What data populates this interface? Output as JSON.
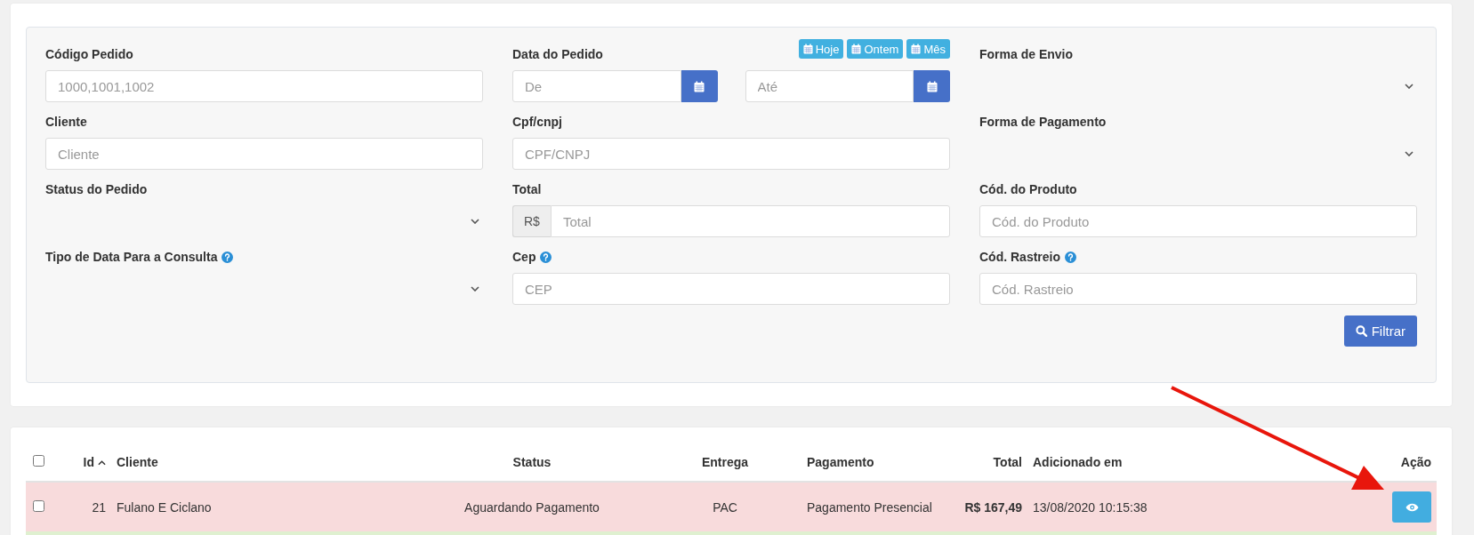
{
  "filters": {
    "fields": [
      {
        "kind": "text",
        "label": "Código Pedido",
        "placeholder": "1000,1001,1002",
        "help": false
      },
      {
        "kind": "date_range",
        "label": "Data do Pedido",
        "from_placeholder": "De",
        "to_placeholder": "Até",
        "quick_buttons": [
          "Hoje",
          "Ontem",
          "Mês"
        ],
        "help": false
      },
      {
        "kind": "select",
        "label": "Forma de Envio",
        "help": false
      },
      {
        "kind": "text",
        "label": "Cliente",
        "placeholder": "Cliente",
        "help": false
      },
      {
        "kind": "text",
        "label": "Cpf/cnpj",
        "placeholder": "CPF/CNPJ",
        "help": false
      },
      {
        "kind": "select",
        "label": "Forma de Pagamento",
        "help": false
      },
      {
        "kind": "select",
        "label": "Status do Pedido",
        "help": false
      },
      {
        "kind": "addon",
        "label": "Total",
        "addon": "R$",
        "placeholder": "Total",
        "help": false
      },
      {
        "kind": "text",
        "label": "Cód. do Produto",
        "placeholder": "Cód. do Produto",
        "help": false
      },
      {
        "kind": "select",
        "label": "Tipo de Data Para a Consulta",
        "help": true
      },
      {
        "kind": "text",
        "label": "Cep",
        "placeholder": "CEP",
        "help": true
      },
      {
        "kind": "text",
        "label": "Cód. Rastreio",
        "placeholder": "Cód. Rastreio",
        "help": true
      }
    ],
    "submit": "Filtrar"
  },
  "table": {
    "select_all": {
      "checked": false
    },
    "columns": [
      {
        "label": "Id",
        "sorted": true
      },
      {
        "label": "Cliente",
        "sorted": false
      },
      {
        "label": "Status",
        "sorted": false
      },
      {
        "label": "Entrega",
        "sorted": false
      },
      {
        "label": "Pagamento",
        "sorted": false
      },
      {
        "label": "Total",
        "sorted": false
      },
      {
        "label": "Adicionado em",
        "sorted": false
      },
      {
        "label": "Ação",
        "sorted": false
      }
    ],
    "rows": [
      {
        "checked": false,
        "color": "#f8dbdc",
        "id": "21",
        "cliente": "Fulano E Ciclano",
        "status": "Aguardando Pagamento",
        "entrega": "PAC",
        "pagamento": "Pagamento Presencial",
        "total": "R$ 167,49",
        "adicionado": "13/08/2020 10:15:38"
      },
      {
        "color": "#dff0d0"
      }
    ]
  }
}
